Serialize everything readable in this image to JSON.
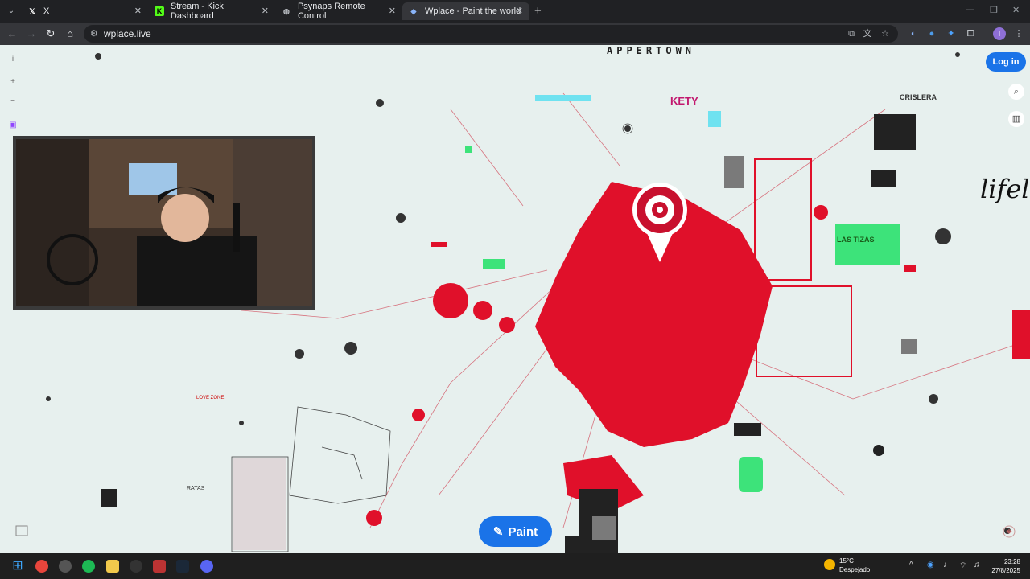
{
  "browser": {
    "tabs": [
      {
        "title": "X",
        "icon": "x-logo-icon",
        "active": false
      },
      {
        "title": "Stream - Kick Dashboard",
        "icon": "kick-icon",
        "active": false
      },
      {
        "title": "Psynaps Remote Control",
        "icon": "globe-icon",
        "active": false
      },
      {
        "title": "Wplace - Paint the world",
        "icon": "wplace-icon",
        "active": true
      }
    ],
    "url": "wplace.live"
  },
  "map": {
    "labels": {
      "top_banner": "APPERTOWN",
      "kety": "KETY",
      "criolera": "CRISLERA",
      "lifelov": "lifelov",
      "las_tizas": "LAS TIZAS",
      "ratas": "RATAS",
      "love_zone": "LOVE ZONE"
    },
    "accent_red": "#e0102a",
    "background": "#e7f0ee"
  },
  "app": {
    "login_label": "Log in",
    "paint_label": "Paint",
    "left_controls": [
      "info-icon",
      "zoom-in-icon",
      "zoom-out-icon",
      "twitch-icon"
    ],
    "right_controls": [
      "search-icon",
      "leaderboard-icon"
    ],
    "locate_icon": "crosshair-icon"
  },
  "taskbar": {
    "weather_temp": "15°C",
    "weather_desc": "Despejado",
    "time": "23:28",
    "date": "27/8/2025"
  }
}
